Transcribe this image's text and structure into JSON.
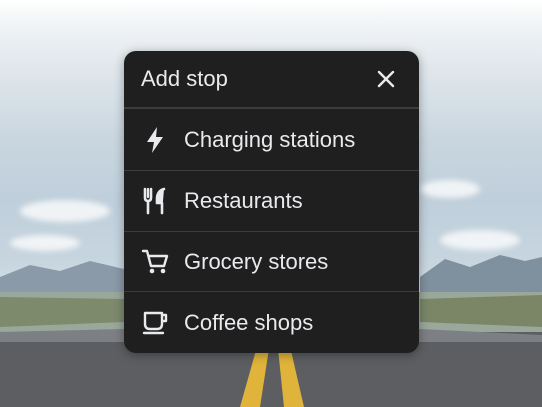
{
  "dialog": {
    "title": "Add stop",
    "close_icon": "close-icon",
    "items": [
      {
        "label": "Charging stations",
        "icon": "lightning-bolt-icon"
      },
      {
        "label": "Restaurants",
        "icon": "fork-knife-icon"
      },
      {
        "label": "Grocery stores",
        "icon": "shopping-cart-icon"
      },
      {
        "label": "Coffee shops",
        "icon": "coffee-cup-icon"
      }
    ]
  },
  "colors": {
    "panel": "#1f1f1f",
    "text": "#e8eaed",
    "divider": "#3c3c3c"
  }
}
